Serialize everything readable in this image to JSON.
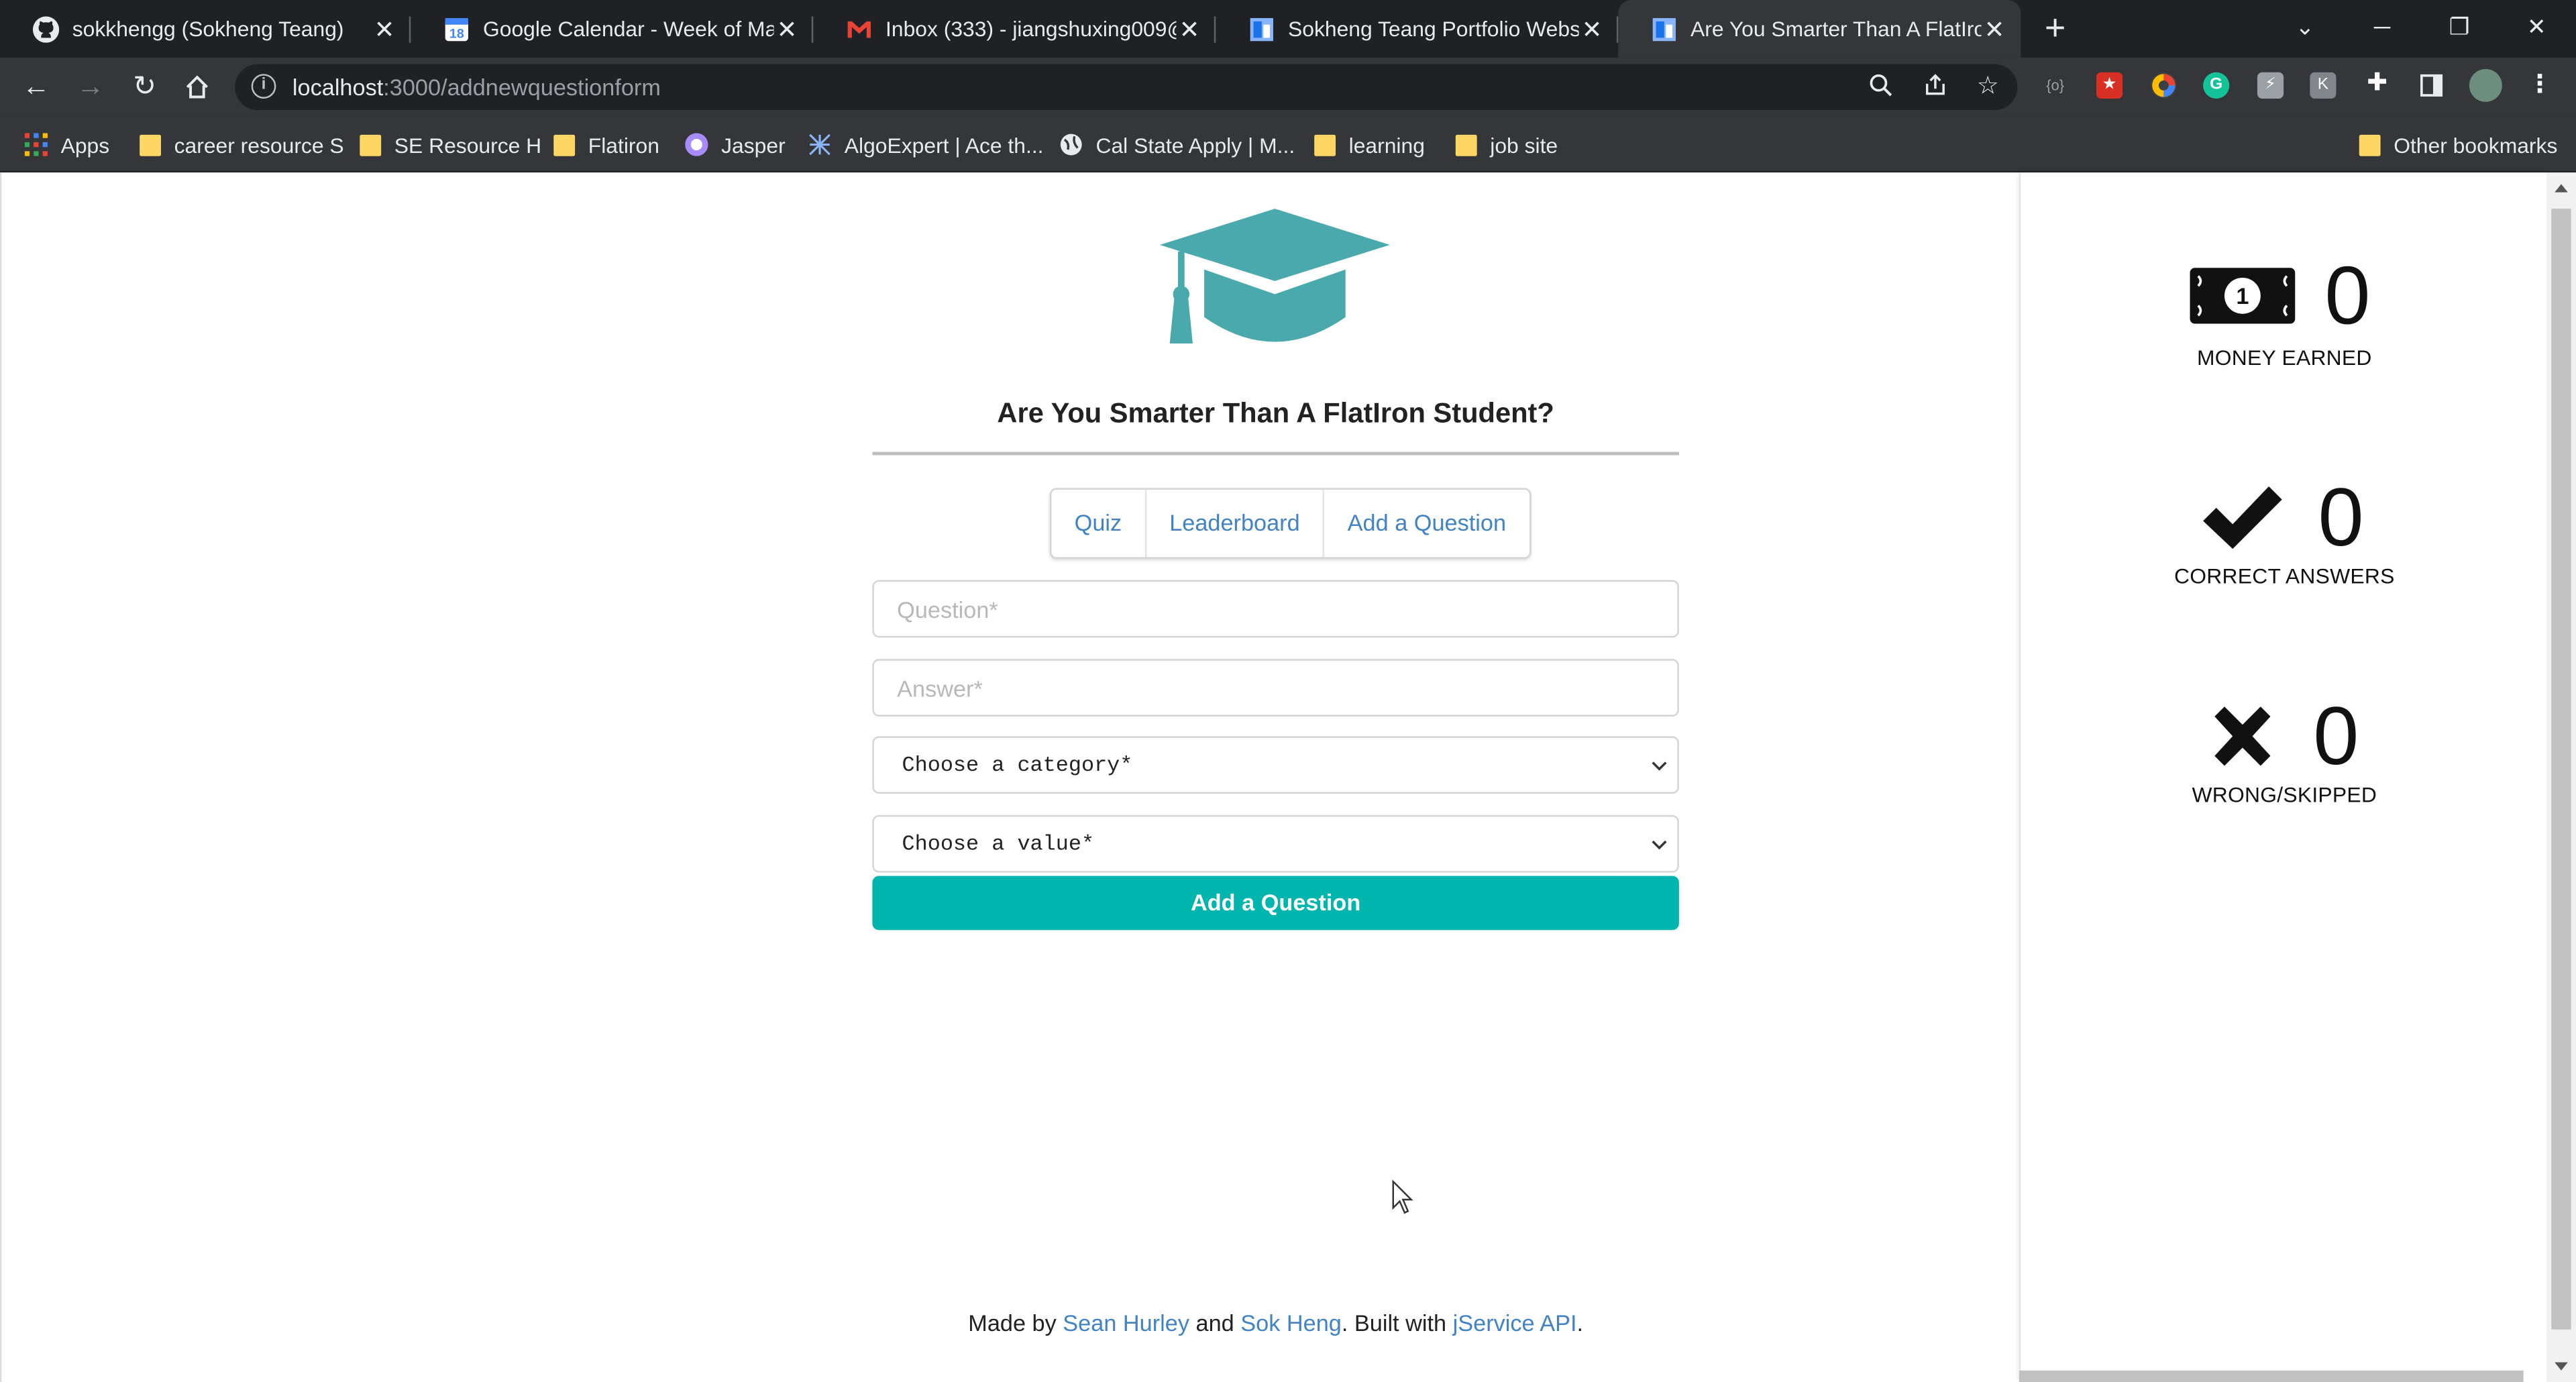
{
  "browser": {
    "tabs": [
      {
        "title": "sokkhengg (Sokheng Teang)",
        "icon": "github-icon"
      },
      {
        "title": "Google Calendar - Week of May",
        "icon": "calendar-icon"
      },
      {
        "title": "Inbox (333) - jiangshuxing009@g",
        "icon": "gmail-icon"
      },
      {
        "title": "Sokheng Teang Portfolio Website",
        "icon": "portfolio-icon"
      },
      {
        "title": "Are You Smarter Than A FlatIron",
        "icon": "portfolio-icon",
        "active": true
      }
    ],
    "url_host": "localhost",
    "url_path": ":3000/addnewquestionform",
    "bookmarks": [
      {
        "label": "Apps",
        "icon": "apps-grid-icon"
      },
      {
        "label": "career resource S",
        "icon": "folder-icon"
      },
      {
        "label": "SE Resource H",
        "icon": "folder-icon"
      },
      {
        "label": "Flatiron",
        "icon": "folder-icon"
      },
      {
        "label": "Jasper",
        "icon": "jasper-icon"
      },
      {
        "label": "AlgoExpert | Ace th...",
        "icon": "algoexpert-icon"
      },
      {
        "label": "Cal State Apply | M...",
        "icon": "globe-icon"
      },
      {
        "label": "learning",
        "icon": "folder-icon"
      },
      {
        "label": "job site",
        "icon": "folder-icon"
      }
    ],
    "other_bookmarks": "Other bookmarks"
  },
  "app": {
    "title": "Are You Smarter Than A FlatIron Student?",
    "menu": [
      "Quiz",
      "Leaderboard",
      "Add a Question"
    ],
    "form": {
      "question_placeholder": "Question*",
      "answer_placeholder": "Answer*",
      "category_select": "Choose a category*",
      "value_select": "Choose a value*",
      "submit_label": "Add a Question"
    },
    "footer": {
      "made_by": "Made by ",
      "author1": "Sean Hurley",
      "and": " and ",
      "author2": "Sok Heng",
      "built_with": ". Built with ",
      "api": "jService API",
      "end": "."
    }
  },
  "scoreboard": {
    "money": {
      "value": "0",
      "label": "MONEY EARNED",
      "icon": "money-bill-icon"
    },
    "correct": {
      "value": "0",
      "label": "CORRECT ANSWERS",
      "icon": "checkmark-icon"
    },
    "wrong": {
      "value": "0",
      "label": "WRONG/SKIPPED",
      "icon": "x-mark-icon"
    }
  },
  "colors": {
    "accent": "#00b5ad",
    "logo": "#4aa9ad",
    "link": "#4183c4",
    "chrome_dark": "#202124",
    "chrome_toolbar": "#35363a"
  }
}
